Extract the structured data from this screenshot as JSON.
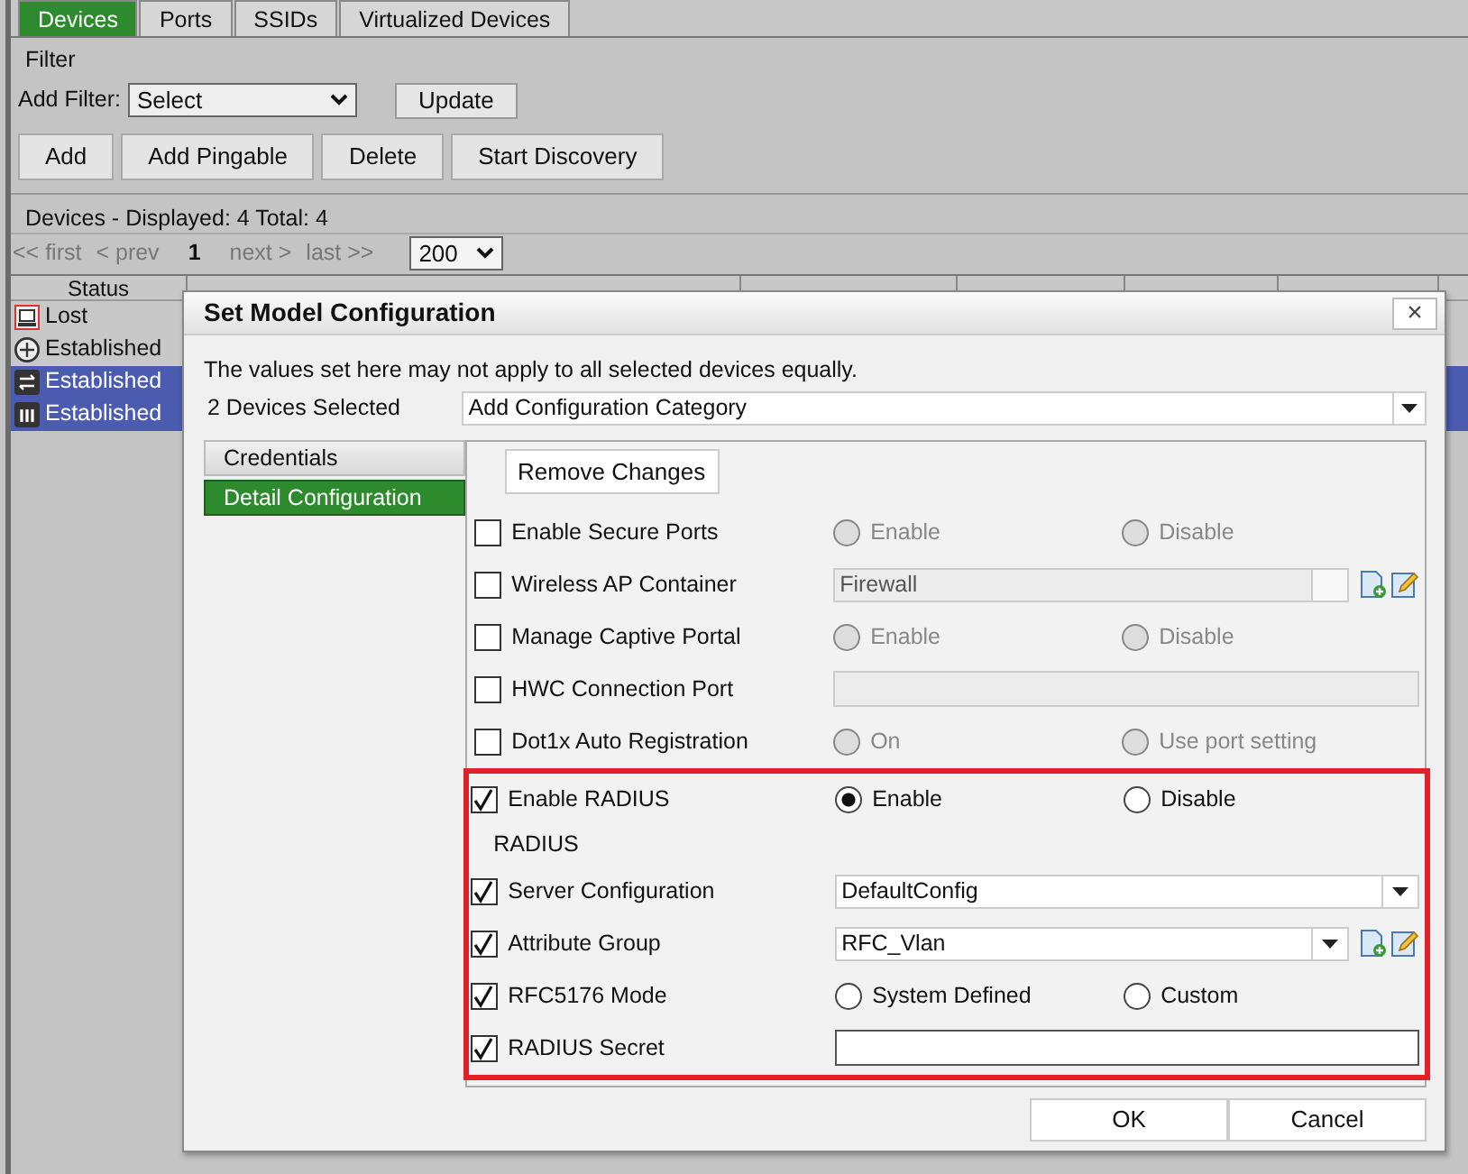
{
  "tabs": [
    {
      "label": "Devices",
      "selected": true
    },
    {
      "label": "Ports",
      "selected": false
    },
    {
      "label": "SSIDs",
      "selected": false
    },
    {
      "label": "Virtualized Devices",
      "selected": false
    }
  ],
  "filter": {
    "title": "Filter",
    "add_filter_label": "Add Filter:",
    "select_value": "Select",
    "update_button": "Update"
  },
  "actions": [
    "Add",
    "Add Pingable",
    "Delete",
    "Start Discovery"
  ],
  "devices_summary": "Devices - Displayed: 4 Total: 4",
  "pager": {
    "links": [
      {
        "label": "<< first",
        "selected": false
      },
      {
        "label": "< prev",
        "selected": false
      },
      {
        "label": "1",
        "selected": true
      },
      {
        "label": "next >",
        "selected": false
      },
      {
        "label": "last >>",
        "selected": false
      }
    ],
    "page_size": "200"
  },
  "table": {
    "columns": [
      "Status"
    ],
    "rows": [
      {
        "status": "Lost",
        "selected": false
      },
      {
        "status": "Established",
        "selected": false
      },
      {
        "status": "Established",
        "selected": true
      },
      {
        "status": "Established",
        "selected": true
      }
    ]
  },
  "dialog": {
    "title": "Set Model Configuration",
    "close": "×",
    "note": "The values set here may not apply to all selected devices equally.",
    "devices_selected": "2 Devices Selected",
    "category": "Add Configuration Category",
    "nav": [
      {
        "label": "Credentials",
        "selected": false
      },
      {
        "label": "Detail Configuration",
        "selected": true
      }
    ],
    "remove_changes": "Remove Changes",
    "sections": [
      {
        "highlighted": false,
        "rows": [
          {
            "kind": "radio",
            "label": "Enable Secure Ports",
            "checked": false,
            "disabled": true,
            "options": [
              {
                "label": "Enable",
                "selected": false
              },
              {
                "label": "Disable",
                "selected": false
              }
            ]
          },
          {
            "kind": "combo",
            "label": "Wireless AP Container",
            "checked": false,
            "disabled": true,
            "value": "Firewall",
            "tools": true
          },
          {
            "kind": "radio",
            "label": "Manage Captive Portal",
            "checked": false,
            "disabled": true,
            "options": [
              {
                "label": "Enable",
                "selected": false
              },
              {
                "label": "Disable",
                "selected": false
              }
            ]
          },
          {
            "kind": "text",
            "label": "HWC Connection Port",
            "checked": false,
            "disabled": true
          },
          {
            "kind": "radio",
            "label": "Dot1x Auto Registration",
            "checked": false,
            "disabled": true,
            "options": [
              {
                "label": "On",
                "selected": false
              },
              {
                "label": "Use port setting",
                "selected": false
              }
            ]
          }
        ]
      },
      {
        "highlighted": true,
        "rows": [
          {
            "kind": "radio",
            "label": "Enable RADIUS",
            "checked": true,
            "disabled": false,
            "options": [
              {
                "label": "Enable",
                "selected": true
              },
              {
                "label": "Disable",
                "selected": false
              }
            ]
          },
          {
            "kind": "heading",
            "label": "RADIUS"
          },
          {
            "kind": "select",
            "label": "Server Configuration",
            "checked": true,
            "disabled": false,
            "value": "DefaultConfig",
            "tools": false
          },
          {
            "kind": "select",
            "label": "Attribute Group",
            "checked": true,
            "disabled": false,
            "value": "RFC_Vlan",
            "tools": true
          },
          {
            "kind": "radio",
            "label": "RFC5176 Mode",
            "checked": true,
            "disabled": false,
            "options": [
              {
                "label": "System Defined",
                "selected": false
              },
              {
                "label": "Custom",
                "selected": false
              }
            ]
          },
          {
            "kind": "text",
            "label": "RADIUS Secret",
            "checked": true,
            "disabled": false
          }
        ]
      }
    ],
    "buttons": [
      "OK",
      "Cancel"
    ]
  }
}
